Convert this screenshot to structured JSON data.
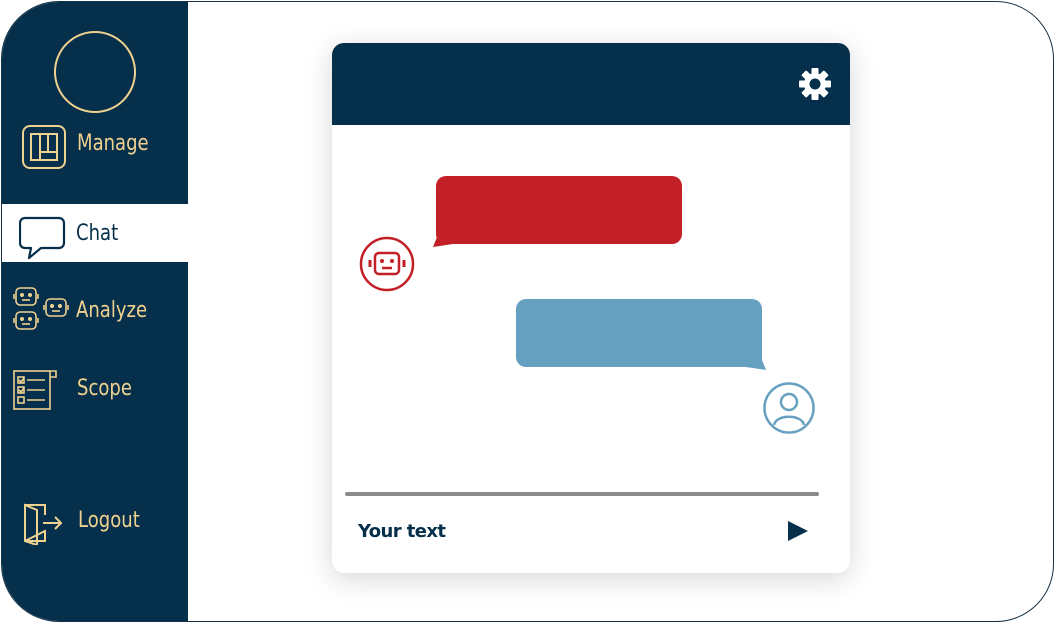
{
  "sidebar": {
    "items": [
      {
        "id": "manage",
        "label": "Manage",
        "icon": "board-icon",
        "active": false
      },
      {
        "id": "chat",
        "label": "Chat",
        "icon": "speech-bubble-icon",
        "active": true
      },
      {
        "id": "analyze",
        "label": "Analyze",
        "icon": "bots-group-icon",
        "active": false
      },
      {
        "id": "scope",
        "label": "Scope",
        "icon": "checklist-icon",
        "active": false
      }
    ],
    "logout_label": "Logout"
  },
  "chat": {
    "input_placeholder": "Your text",
    "messages": [
      {
        "sender": "bot",
        "color": "#c21f27"
      },
      {
        "sender": "user",
        "color": "#66a0c0"
      }
    ]
  },
  "colors": {
    "navy": "#052f4a",
    "gold": "#f0d290",
    "red": "#c21f27",
    "blue": "#66a0c0"
  }
}
